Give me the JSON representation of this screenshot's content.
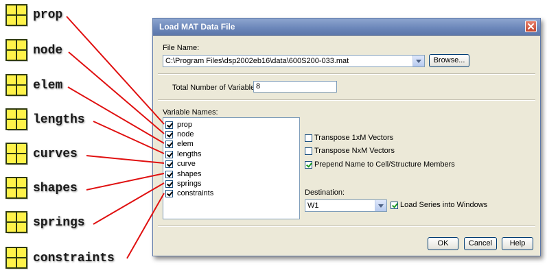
{
  "annotations": {
    "variables": [
      "prop",
      "node",
      "elem",
      "lengths",
      "curves",
      "shapes",
      "springs",
      "constraints"
    ]
  },
  "dialog": {
    "title": "Load MAT Data File",
    "file_name_label": "File Name:",
    "file_path": "C:\\Program Files\\dsp2002eb16\\data\\600S200-033.mat",
    "browse_label": "Browse...",
    "total_vars_label": "Total Number of Variables:",
    "total_vars_value": "8",
    "variable_names_label": "Variable Names:",
    "variables": [
      {
        "name": "prop",
        "checked": true
      },
      {
        "name": "node",
        "checked": true
      },
      {
        "name": "elem",
        "checked": true
      },
      {
        "name": "lengths",
        "checked": true
      },
      {
        "name": "curve",
        "checked": true
      },
      {
        "name": "shapes",
        "checked": true
      },
      {
        "name": "springs",
        "checked": true
      },
      {
        "name": "constraints",
        "checked": true
      }
    ],
    "options": {
      "transpose_1xm": {
        "label": "Transpose 1xM Vectors",
        "checked": false
      },
      "transpose_nxm": {
        "label": "Transpose NxM Vectors",
        "checked": false
      },
      "prepend_name": {
        "label": "Prepend Name to Cell/Structure Members",
        "checked": true
      }
    },
    "destination_label": "Destination:",
    "destination_value": "W1",
    "load_series": {
      "label": "Load Series into Windows",
      "checked": true
    },
    "ok_label": "OK",
    "cancel_label": "Cancel",
    "help_label": "Help"
  },
  "colors": {
    "connector_line": "#e01010",
    "icon_fill": "#fff34a",
    "icon_border": "#2f3a12",
    "title_bar": "#6d88bb"
  }
}
